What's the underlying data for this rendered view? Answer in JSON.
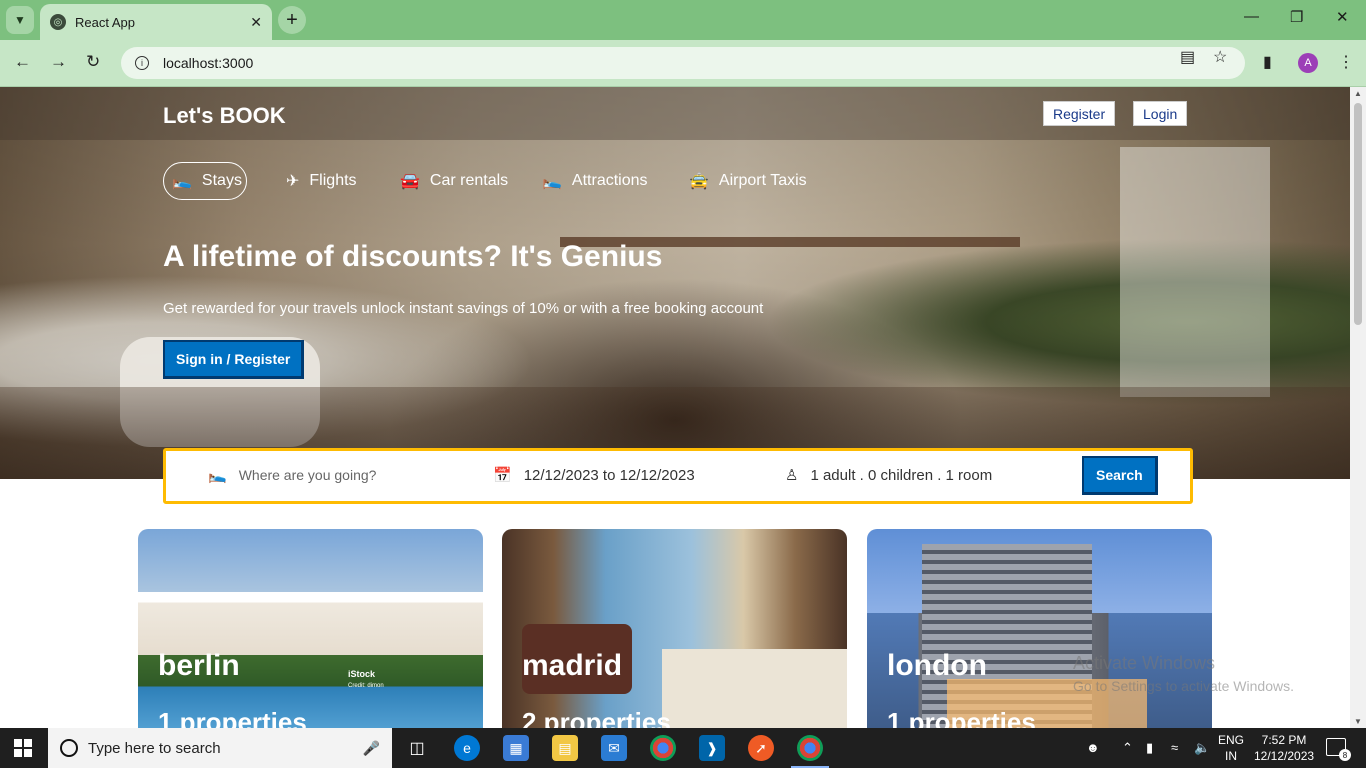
{
  "browser": {
    "tab_title": "React App",
    "url": "localhost:3000",
    "profile_initial": "A",
    "icons": [
      "tab-search-icon",
      "globe-icon",
      "close-icon",
      "plus-icon",
      "minimize-icon",
      "restore-icon",
      "close-window-icon",
      "back-icon",
      "forward-icon",
      "reload-icon",
      "info-icon",
      "install-icon",
      "star-icon",
      "sidepanel-icon",
      "menu-icon"
    ]
  },
  "site": {
    "brand": "Let's BOOK",
    "register": "Register",
    "login": "Login",
    "categories": [
      {
        "label": "Stays",
        "icon": "bed-icon",
        "active": true
      },
      {
        "label": "Flights",
        "icon": "plane-icon",
        "active": false
      },
      {
        "label": "Car rentals",
        "icon": "car-icon",
        "active": false
      },
      {
        "label": "Attractions",
        "icon": "bed-icon",
        "active": false
      },
      {
        "label": "Airport Taxis",
        "icon": "taxi-icon",
        "active": false
      }
    ],
    "headline": "A lifetime of discounts? It's Genius",
    "subline": "Get rewarded for your travels unlock instant savings of 10% or with a free booking account",
    "signin": "Sign in / Register",
    "search": {
      "destination_placeholder": "Where are you going?",
      "dates": "12/12/2023 to 12/12/2023",
      "guests": "1 adult . 0 children . 1 room",
      "button": "Search"
    },
    "cities": [
      {
        "name": "berlin",
        "properties": "1 properties"
      },
      {
        "name": "madrid",
        "properties": "2 properties"
      },
      {
        "name": "london",
        "properties": "1 properties"
      }
    ],
    "istock": "iStock",
    "istock_credit": "Credit: dimon"
  },
  "watermark": {
    "line1": "Activate Windows",
    "line2": "Go to Settings to activate Windows."
  },
  "taskbar": {
    "search_placeholder": "Type here to search",
    "lang_top": "ENG",
    "lang_bottom": "IN",
    "time": "7:52 PM",
    "date": "12/12/2023",
    "notifications": "8"
  },
  "colors": {
    "chrome_tab_bar": "#7dc07f",
    "chrome_toolbar": "#c6e6c6",
    "primary_button": "#0071c2",
    "search_border": "#febb02"
  }
}
